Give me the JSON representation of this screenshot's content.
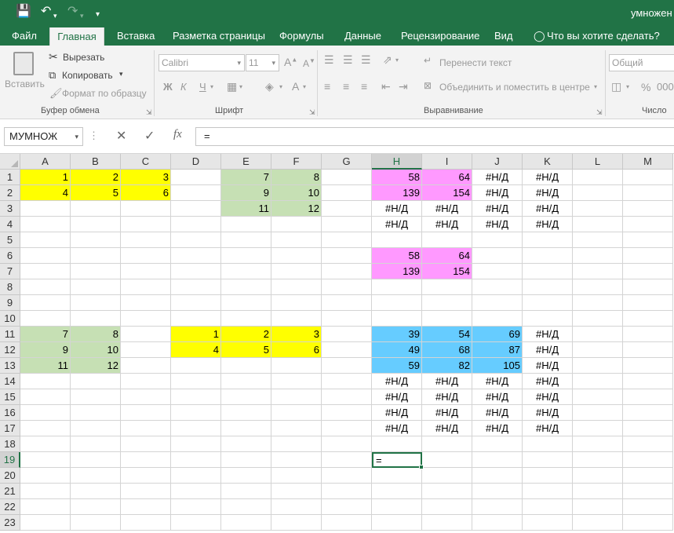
{
  "colors": {
    "accent": "#217346",
    "yellow": "#ffff00",
    "green": "#c6e0b4",
    "pink": "#ff99ff",
    "blue": "#66ccff"
  },
  "titlebar": {
    "title": "умножен"
  },
  "tabs": [
    "Файл",
    "Главная",
    "Вставка",
    "Разметка страницы",
    "Формулы",
    "Данные",
    "Рецензирование",
    "Вид"
  ],
  "tellme": "Что вы хотите сделать?",
  "ribbon": {
    "clipboard": {
      "paste": "Вставить",
      "cut": "Вырезать",
      "copy": "Копировать",
      "format_painter": "Формат по образцу",
      "label": "Буфер обмена"
    },
    "font": {
      "name": "Calibri",
      "size": "11",
      "bold": "Ж",
      "italic": "К",
      "underline": "Ч",
      "label": "Шрифт"
    },
    "alignment": {
      "wrap": "Перенести текст",
      "merge": "Объединить и поместить в центре",
      "label": "Выравнивание"
    },
    "number": {
      "format": "Общий",
      "label": "Число"
    }
  },
  "formula_bar": {
    "name_box": "МУМНОЖ",
    "cancel": "✕",
    "enter": "✓",
    "fx": "fx",
    "content": "="
  },
  "columns": [
    "A",
    "B",
    "C",
    "D",
    "E",
    "F",
    "G",
    "H",
    "I",
    "J",
    "K",
    "L",
    "M"
  ],
  "rows": [
    "1",
    "2",
    "3",
    "4",
    "5",
    "6",
    "7",
    "8",
    "9",
    "10",
    "11",
    "12",
    "13",
    "14",
    "15",
    "16",
    "17",
    "18",
    "19",
    "20",
    "21",
    "22",
    "23"
  ],
  "cells": [
    {
      "ref": "A1",
      "v": "1",
      "fill": "yellow"
    },
    {
      "ref": "B1",
      "v": "2",
      "fill": "yellow"
    },
    {
      "ref": "C1",
      "v": "3",
      "fill": "yellow"
    },
    {
      "ref": "A2",
      "v": "4",
      "fill": "yellow"
    },
    {
      "ref": "B2",
      "v": "5",
      "fill": "yellow"
    },
    {
      "ref": "C2",
      "v": "6",
      "fill": "yellow"
    },
    {
      "ref": "E1",
      "v": "7",
      "fill": "green"
    },
    {
      "ref": "F1",
      "v": "8",
      "fill": "green"
    },
    {
      "ref": "E2",
      "v": "9",
      "fill": "green"
    },
    {
      "ref": "F2",
      "v": "10",
      "fill": "green"
    },
    {
      "ref": "E3",
      "v": "11",
      "fill": "green"
    },
    {
      "ref": "F3",
      "v": "12",
      "fill": "green"
    },
    {
      "ref": "H1",
      "v": "58",
      "fill": "pink"
    },
    {
      "ref": "I1",
      "v": "64",
      "fill": "pink"
    },
    {
      "ref": "J1",
      "v": "#Н/Д"
    },
    {
      "ref": "K1",
      "v": "#Н/Д"
    },
    {
      "ref": "H2",
      "v": "139",
      "fill": "pink"
    },
    {
      "ref": "I2",
      "v": "154",
      "fill": "pink"
    },
    {
      "ref": "J2",
      "v": "#Н/Д"
    },
    {
      "ref": "K2",
      "v": "#Н/Д"
    },
    {
      "ref": "H3",
      "v": "#Н/Д"
    },
    {
      "ref": "I3",
      "v": "#Н/Д"
    },
    {
      "ref": "J3",
      "v": "#Н/Д"
    },
    {
      "ref": "K3",
      "v": "#Н/Д"
    },
    {
      "ref": "H4",
      "v": "#Н/Д"
    },
    {
      "ref": "I4",
      "v": "#Н/Д"
    },
    {
      "ref": "J4",
      "v": "#Н/Д"
    },
    {
      "ref": "K4",
      "v": "#Н/Д"
    },
    {
      "ref": "H6",
      "v": "58",
      "fill": "pink"
    },
    {
      "ref": "I6",
      "v": "64",
      "fill": "pink"
    },
    {
      "ref": "H7",
      "v": "139",
      "fill": "pink"
    },
    {
      "ref": "I7",
      "v": "154",
      "fill": "pink"
    },
    {
      "ref": "A11",
      "v": "7",
      "fill": "green"
    },
    {
      "ref": "B11",
      "v": "8",
      "fill": "green"
    },
    {
      "ref": "A12",
      "v": "9",
      "fill": "green"
    },
    {
      "ref": "B12",
      "v": "10",
      "fill": "green"
    },
    {
      "ref": "A13",
      "v": "11",
      "fill": "green"
    },
    {
      "ref": "B13",
      "v": "12",
      "fill": "green"
    },
    {
      "ref": "D11",
      "v": "1",
      "fill": "yellow"
    },
    {
      "ref": "E11",
      "v": "2",
      "fill": "yellow"
    },
    {
      "ref": "F11",
      "v": "3",
      "fill": "yellow"
    },
    {
      "ref": "D12",
      "v": "4",
      "fill": "yellow"
    },
    {
      "ref": "E12",
      "v": "5",
      "fill": "yellow"
    },
    {
      "ref": "F12",
      "v": "6",
      "fill": "yellow"
    },
    {
      "ref": "H11",
      "v": "39",
      "fill": "blue"
    },
    {
      "ref": "I11",
      "v": "54",
      "fill": "blue"
    },
    {
      "ref": "J11",
      "v": "69",
      "fill": "blue"
    },
    {
      "ref": "K11",
      "v": "#Н/Д"
    },
    {
      "ref": "H12",
      "v": "49",
      "fill": "blue"
    },
    {
      "ref": "I12",
      "v": "68",
      "fill": "blue"
    },
    {
      "ref": "J12",
      "v": "87",
      "fill": "blue"
    },
    {
      "ref": "K12",
      "v": "#Н/Д"
    },
    {
      "ref": "H13",
      "v": "59",
      "fill": "blue"
    },
    {
      "ref": "I13",
      "v": "82",
      "fill": "blue"
    },
    {
      "ref": "J13",
      "v": "105",
      "fill": "blue"
    },
    {
      "ref": "K13",
      "v": "#Н/Д"
    },
    {
      "ref": "H14",
      "v": "#Н/Д"
    },
    {
      "ref": "I14",
      "v": "#Н/Д"
    },
    {
      "ref": "J14",
      "v": "#Н/Д"
    },
    {
      "ref": "K14",
      "v": "#Н/Д"
    },
    {
      "ref": "H15",
      "v": "#Н/Д"
    },
    {
      "ref": "I15",
      "v": "#Н/Д"
    },
    {
      "ref": "J15",
      "v": "#Н/Д"
    },
    {
      "ref": "K15",
      "v": "#Н/Д"
    },
    {
      "ref": "H16",
      "v": "#Н/Д"
    },
    {
      "ref": "I16",
      "v": "#Н/Д"
    },
    {
      "ref": "J16",
      "v": "#Н/Д"
    },
    {
      "ref": "K16",
      "v": "#Н/Д"
    },
    {
      "ref": "H17",
      "v": "#Н/Д"
    },
    {
      "ref": "I17",
      "v": "#Н/Д"
    },
    {
      "ref": "J17",
      "v": "#Н/Д"
    },
    {
      "ref": "K17",
      "v": "#Н/Д"
    },
    {
      "ref": "H19",
      "v": "=",
      "active": true
    }
  ]
}
